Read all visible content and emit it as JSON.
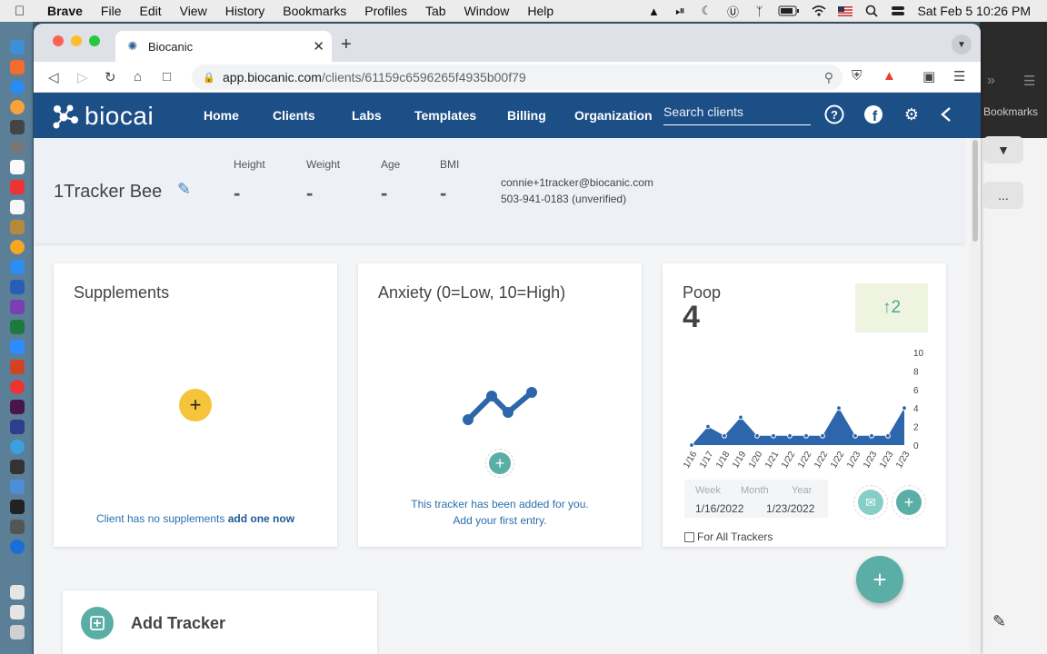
{
  "menubar": {
    "app": "Brave",
    "items": [
      "File",
      "Edit",
      "View",
      "History",
      "Bookmarks",
      "Profiles",
      "Tab",
      "Window",
      "Help"
    ],
    "datetime": "Sat Feb 5  10:26 PM"
  },
  "browser": {
    "tab_title": "Biocanic",
    "url_host": "app.biocanic.com",
    "url_path": "/clients/61159c6596265f4935b00f79"
  },
  "background_window": {
    "bookmarks_label": "Bookmarks",
    "more_label": "..."
  },
  "app": {
    "logo_text": "biocai",
    "nav": [
      "Home",
      "Clients",
      "Labs",
      "Templates",
      "Billing",
      "Organization"
    ],
    "search_placeholder": "Search clients"
  },
  "client": {
    "name": "1Tracker Bee",
    "stats": [
      {
        "label": "Height",
        "value": "-"
      },
      {
        "label": "Weight",
        "value": "-"
      },
      {
        "label": "Age",
        "value": "-"
      },
      {
        "label": "BMI",
        "value": "-"
      }
    ],
    "email": "connie+1tracker@biocanic.com",
    "phone": "503-941-0183 (unverified)"
  },
  "supplements": {
    "title": "Supplements",
    "empty_text": "Client has no supplements",
    "add_link": "add one now"
  },
  "anxiety": {
    "title": "Anxiety (0=Low, 10=High)",
    "msg_line1": "This tracker has been added for you.",
    "msg_line2": "Add your first entry."
  },
  "poop": {
    "title": "Poop",
    "current_value": "4",
    "badge": "↑2",
    "range_tabs": [
      "Week",
      "Month",
      "Year"
    ],
    "start_date": "1/16/2022",
    "end_date": "1/23/2022",
    "for_all_label": "For All Trackers"
  },
  "chart_data": {
    "type": "area",
    "x": [
      "1/16",
      "1/17",
      "1/18",
      "1/19",
      "1/20",
      "1/21",
      "1/22",
      "1/22",
      "1/22",
      "1/22",
      "1/23",
      "1/23",
      "1/23",
      "1/23"
    ],
    "values": [
      0,
      2,
      1,
      3,
      1,
      1,
      1,
      1,
      1,
      4,
      1,
      1,
      1,
      4
    ],
    "ylim": [
      0,
      10
    ],
    "yticks": [
      "10",
      "8",
      "6",
      "4",
      "2",
      "0"
    ],
    "color": "#2e66ab"
  },
  "add_tracker": {
    "label": "Add Tracker"
  },
  "colors": {
    "header": "#1d4f87",
    "accent_teal": "#5aaea6",
    "accent_yellow": "#f5c43a"
  }
}
